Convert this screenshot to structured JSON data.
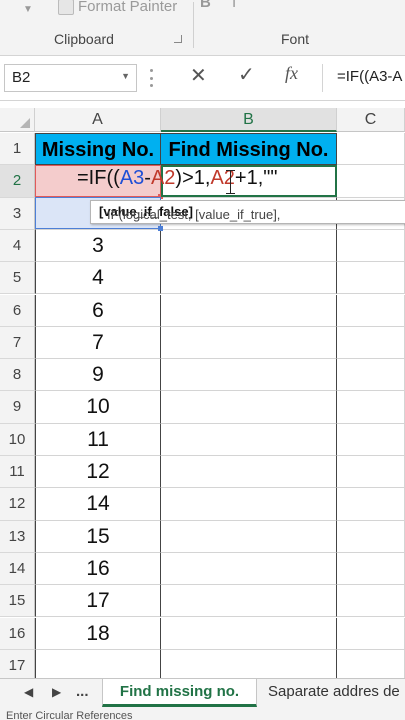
{
  "ribbon": {
    "format_painter_label": "Format Painter",
    "clipboard_group": "Clipboard",
    "font_group": "Font",
    "bold_label": "B",
    "italic_label": "I"
  },
  "formula_bar": {
    "name_box": "B2",
    "cancel_glyph": "✕",
    "enter_glyph": "✓",
    "fx_glyph": "fx",
    "content": "=IF((A3-A"
  },
  "columns": [
    "A",
    "B",
    "C"
  ],
  "rows": [
    "1",
    "2",
    "3",
    "4",
    "5",
    "6",
    "7",
    "8",
    "9",
    "10",
    "11",
    "12",
    "13",
    "14",
    "15",
    "16",
    "17"
  ],
  "headers": {
    "a1": "Missing No.",
    "b1": "Find Missing No."
  },
  "values": [
    "3",
    "4",
    "6",
    "7",
    "9",
    "10",
    "11",
    "12",
    "14",
    "15",
    "16",
    "17",
    "18"
  ],
  "editing": {
    "prefix": "=IF(",
    "paren": "(",
    "ref1": "A3",
    "minus": "-",
    "ref2": "A2",
    "mid": ")>1,",
    "ref3": "A2",
    "suffix": "+1,\"\""
  },
  "tooltip": {
    "text": "IF(logical_test, [value_if_true], ",
    "bold": "[value_if_false]"
  },
  "sheet_tabs": {
    "prev": "◀",
    "next": "▶",
    "ellipsis": "...",
    "active": "Find missing no.",
    "other": "Saparate addres de"
  },
  "status_bar": {
    "text": "Enter   Circular References"
  },
  "colors": {
    "header_fill": "#00b0f0",
    "excel_green": "#217346",
    "ref_red": "#c0392b",
    "ref_blue": "#1f4fd6"
  }
}
